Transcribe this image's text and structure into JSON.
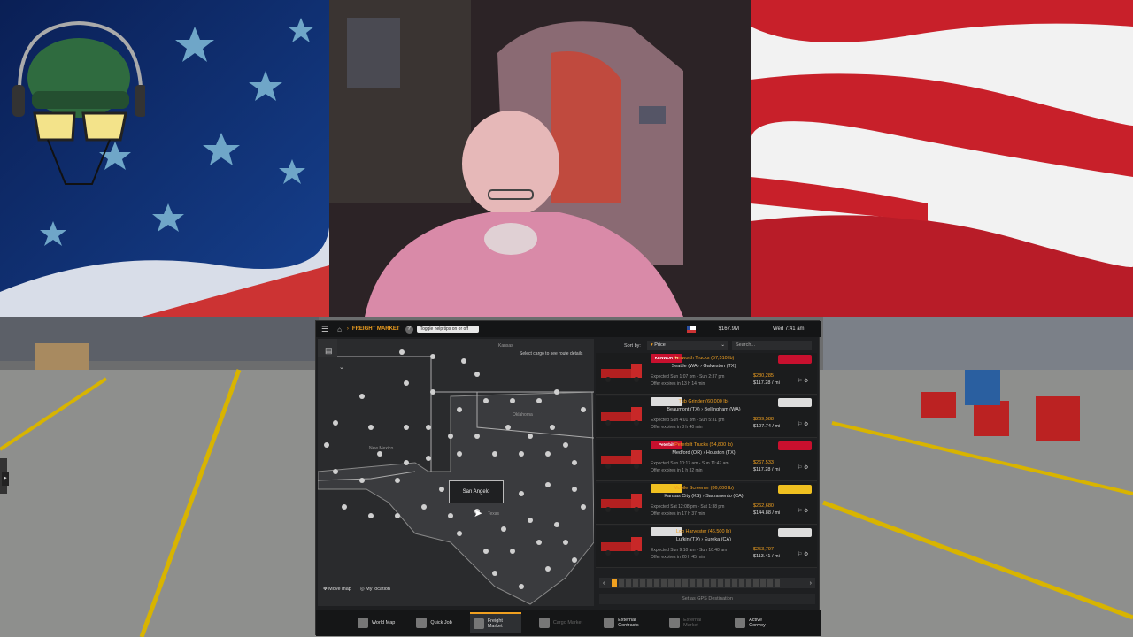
{
  "topbar": {
    "breadcrumb": "FREIGHT MARKET",
    "tooltip": "Toggle help tips on or off",
    "money": "$167.9M",
    "datetime": "Wed 7:41 am"
  },
  "map": {
    "hint": "Select cargo to see route details",
    "labels": [
      "Oklahoma",
      "New Mexico",
      "San Angelo",
      "Texas",
      "Kansas"
    ],
    "tooltip_city": "San Angelo",
    "buttons": {
      "move": "Move map",
      "location": "My location"
    }
  },
  "list": {
    "sort_label": "Sort by:",
    "sort_value": "Price",
    "search_placeholder": "Search...",
    "jobs": [
      {
        "brand": "KENWORTH",
        "name": "Kenworth Trucks (57,510 lb)",
        "route": "Seattle (WA)  ›  Galveston (TX)",
        "expected": "Expected Sun 1:07 pm - Sun 2:37 pm",
        "expires": "Offer expires in 13 h 14 min",
        "pay": "$280,285",
        "per_mile": "$117.28 / mi",
        "brand_color": "#c8102e"
      },
      {
        "brand": "",
        "name": "Tub Grinder (60,000 lb)",
        "route": "Beaumont (TX)  ›  Bellingham (WA)",
        "expected": "Expected Sun 4:01 pm - Sun 5:31 pm",
        "expires": "Offer expires in 8 h 40 min",
        "pay": "$269,588",
        "per_mile": "$107.74 / mi",
        "brand_color": "#dddddd"
      },
      {
        "brand": "Peterbilt",
        "name": "Peterbilt Trucks (54,800 lb)",
        "route": "Medford (OR)  ›  Houston (TX)",
        "expected": "Expected Sun 10:17 am - Sun 11:47 am",
        "expires": "Offer expires in 1 h 32 min",
        "pay": "$267,533",
        "per_mile": "$117.28 / mi",
        "brand_color": "#c8102e"
      },
      {
        "brand": "",
        "name": "Mobile Screener (86,000 lb)",
        "route": "Kansas City (KS)  ›  Sacramento (CA)",
        "expected": "Expected Sat 12:08 pm - Sat 1:38 pm",
        "expires": "Offer expires in 17 h 37 min",
        "pay": "$262,680",
        "per_mile": "$144.88 / mi",
        "brand_color": "#f0c020"
      },
      {
        "brand": "",
        "name": "Log Harvester (46,500 lb)",
        "route": "Lufkin (TX)  ›  Eureka (CA)",
        "expected": "Expected Sun 9:10 am - Sun 10:40 am",
        "expires": "Offer expires in 20 h 45 min",
        "pay": "$253,797",
        "per_mile": "$113.41 / mi",
        "brand_color": "#dddddd"
      }
    ],
    "gps_button": "Set as GPS Destination"
  },
  "bottom_nav": [
    {
      "label": "World Map",
      "active": false,
      "dim": false
    },
    {
      "label": "Quick Job",
      "active": false,
      "dim": false
    },
    {
      "label": "Freight Market",
      "active": true,
      "dim": false
    },
    {
      "label": "Cargo Market",
      "active": false,
      "dim": true
    },
    {
      "label": "External Contracts",
      "active": false,
      "dim": false
    },
    {
      "label": "External Market",
      "active": false,
      "dim": true
    },
    {
      "label": "Active Convoy",
      "active": false,
      "dim": false
    }
  ],
  "colors": {
    "accent": "#f0a020",
    "panel": "#1e1f21"
  }
}
